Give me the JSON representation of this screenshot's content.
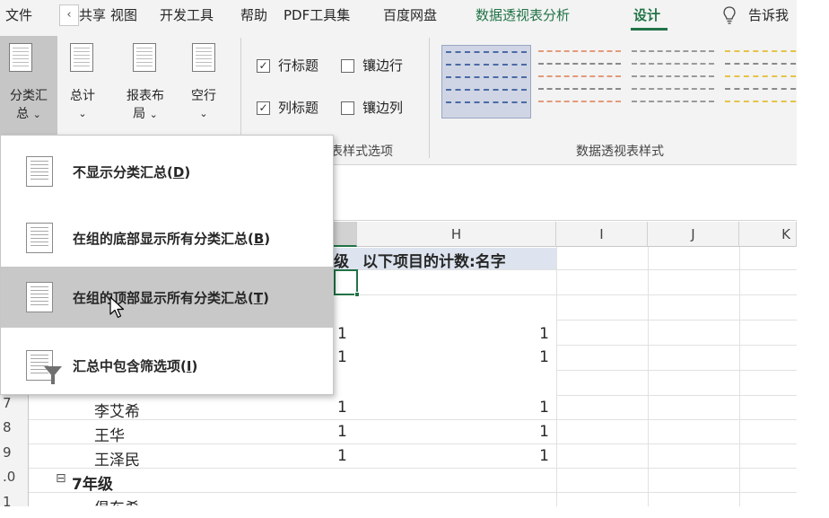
{
  "tabs": {
    "file": "文件",
    "share_partial": "共享",
    "view": "视图",
    "developer": "开发工具",
    "help": "帮助",
    "pdf": "PDF工具集",
    "baidu": "百度网盘",
    "pivot_analyze": "数据透视表分析",
    "design": "设计",
    "tell_me": "告诉我"
  },
  "ribbon": {
    "subtotals_l1": "分类汇",
    "subtotals_l2": "总",
    "grand_totals_l1": "总计",
    "report_layout_l1": "报表布",
    "report_layout_l2": "局",
    "blank_rows_l1": "空行",
    "row_headers": "行标题",
    "banded_rows": "镶边行",
    "col_headers": "列标题",
    "banded_cols": "镶边列",
    "style_options_label": "表样式选项",
    "styles_label": "数据透视表样式",
    "check_mark": "✓",
    "chevron": "⌄"
  },
  "dropdown": {
    "items": [
      {
        "label": "不显示分类汇总(",
        "key": "D"
      },
      {
        "label": "在组的底部显示所有分类汇总(",
        "key": "B"
      },
      {
        "label": "在组的顶部显示所有分类汇总(",
        "key": "T"
      },
      {
        "label": "汇总中包含筛选项(",
        "key": "I"
      }
    ],
    "close_paren": ")"
  },
  "grid": {
    "columns": [
      "H",
      "I",
      "J",
      "K"
    ],
    "header_partial": "级",
    "header_h": "以下项目的计数:名字",
    "rows": [
      {
        "num": "7",
        "name": "李艾希",
        "g": "1",
        "h": "1"
      },
      {
        "num": "8",
        "name": "王华",
        "g": "1",
        "h": "1"
      },
      {
        "num": "9",
        "name": "王泽民",
        "g": "1",
        "h": "1"
      },
      {
        "num": ".0",
        "name": "7年级"
      }
    ],
    "upper_values": [
      {
        "g": "1",
        "h": "1"
      },
      {
        "g": "1",
        "h": "1"
      }
    ],
    "group_toggle": "⊟",
    "partial_row_num": "1",
    "partial_row_name": "俱东希"
  },
  "colors": {
    "accent_green": "#217346",
    "ribbon_bg": "#f3f3f3",
    "hover_gray": "#c8c8c8"
  }
}
